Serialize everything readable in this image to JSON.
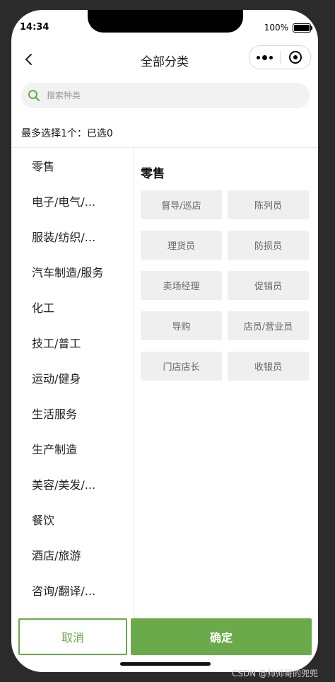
{
  "status_bar": {
    "time": "14:34",
    "battery": "100%"
  },
  "nav": {
    "title": "全部分类"
  },
  "search": {
    "placeholder": "搜索种类",
    "value": ""
  },
  "selection": {
    "limit_text": "最多选择1个：已选0"
  },
  "sidebar": {
    "items": [
      {
        "label": "零售"
      },
      {
        "label": "电子/电气/..."
      },
      {
        "label": "服装/纺织/..."
      },
      {
        "label": "汽车制造/服务"
      },
      {
        "label": "化工"
      },
      {
        "label": "技工/普工"
      },
      {
        "label": "运动/健身"
      },
      {
        "label": "生活服务"
      },
      {
        "label": "生产制造"
      },
      {
        "label": "美容/美发/..."
      },
      {
        "label": "餐饮"
      },
      {
        "label": "酒店/旅游"
      },
      {
        "label": "咨询/翻译/..."
      }
    ]
  },
  "content": {
    "section_title": "零售",
    "tags": [
      {
        "label": "督导/巡店"
      },
      {
        "label": "陈列员"
      },
      {
        "label": "理货员"
      },
      {
        "label": "防损员"
      },
      {
        "label": "卖场经理"
      },
      {
        "label": "促销员"
      },
      {
        "label": "导购"
      },
      {
        "label": "店员/营业员"
      },
      {
        "label": "门店店长"
      },
      {
        "label": "收银员"
      }
    ]
  },
  "footer": {
    "cancel_label": "取消",
    "confirm_label": "确定"
  },
  "watermark": "CSDN @帅帅哥的兜兜",
  "colors": {
    "accent": "#6aaa4a",
    "tag_bg": "#efefef",
    "search_bg": "#f2f2f2"
  },
  "icons": [
    "back-icon",
    "more-icon",
    "close-icon",
    "search-icon",
    "battery-icon"
  ]
}
